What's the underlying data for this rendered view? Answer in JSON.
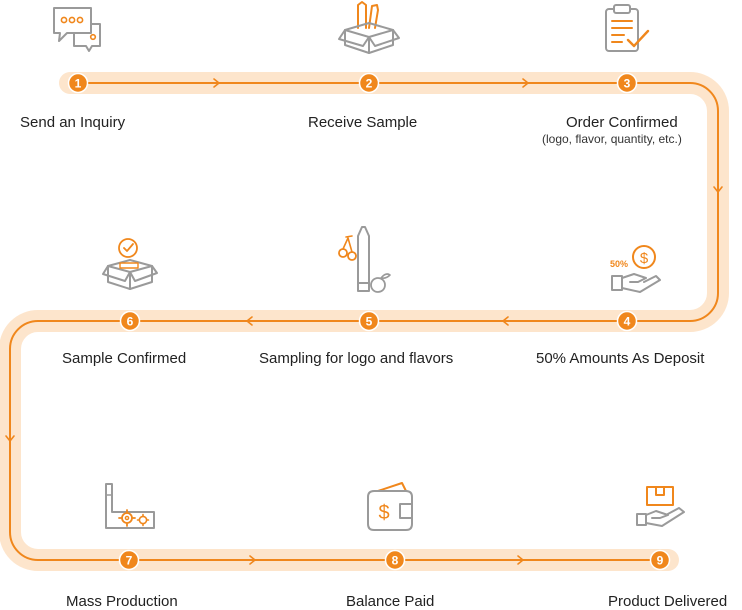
{
  "colors": {
    "accent": "#f0871c",
    "track": "#fde5cc",
    "icon_gray": "#9a9a9a"
  },
  "steps": [
    {
      "number": "1",
      "label": "Send an Inquiry",
      "icon": "chat-bubbles-icon"
    },
    {
      "number": "2",
      "label": "Receive Sample",
      "icon": "open-box-icon"
    },
    {
      "number": "3",
      "label": "Order Confirmed",
      "sublabel": "(logo, flavor, quantity, etc.)",
      "icon": "clipboard-check-icon"
    },
    {
      "number": "4",
      "label": "50% Amounts As Deposit",
      "icon": "hand-dollar-icon",
      "badge": "50%"
    },
    {
      "number": "5",
      "label": "Sampling for logo and flavors",
      "icon": "vape-fruit-icon"
    },
    {
      "number": "6",
      "label": "Sample Confirmed",
      "icon": "box-check-icon"
    },
    {
      "number": "7",
      "label": "Mass Production",
      "icon": "factory-gears-icon"
    },
    {
      "number": "8",
      "label": "Balance Paid",
      "icon": "wallet-dollar-icon"
    },
    {
      "number": "9",
      "label": "Product Delivered",
      "icon": "hand-package-icon"
    }
  ]
}
